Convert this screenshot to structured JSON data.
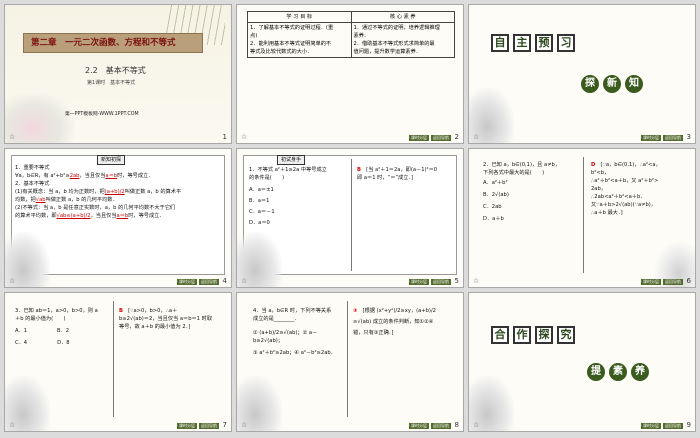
{
  "colors": {
    "frame": "#a8a8a8",
    "accent_green": "#3a5a1e",
    "title_red": "#8b1a1a",
    "answer_red": "#c00000"
  },
  "slides": [
    {
      "num": "1",
      "chapter": "第二章　一元二次函数、方程和不等式",
      "section": "2.2　基本不等式",
      "lesson": "第1课时　基本不等式",
      "site": "第一PPT模板网-WWW.1PPT.COM"
    },
    {
      "num": "2",
      "col1_head": "学 习 目 标",
      "col2_head": "核 心 素 养",
      "col1_lines": [
        "1．了解基本不等式的证明过程．(重",
        "点)",
        "2．能利用基本不等式证明简单的不",
        "等式及比较代数式的大小．"
      ],
      "col2_lines": [
        "1．通过不等式的证明，培养逻辑推理",
        "素养．",
        "2．借助基本不等式形式求简单的最",
        "值问题，提升数学运算素养．"
      ]
    },
    {
      "num": "3",
      "chars_a": [
        "自",
        "主",
        "预",
        "习"
      ],
      "chars_b": [
        "探",
        "新",
        "知"
      ]
    },
    {
      "num": "4",
      "tag": "新知初探",
      "lines": [
        "1．重要不等式",
        "∀a，b∈R，有 a²+b²≥",
        "，当且仅当",
        "时，等号成立．",
        "2．基本不等式",
        "(1)有关概念：当 a，b 均为正数时，把",
        "叫做正数 a，b 的算术平",
        "均数，把",
        "叫做正数 a，b 的几何平均数．",
        "(2)不等式：当 a，b 是任意正实数时，a，b 的几何平均数不大于它们",
        "的算术平均数，即",
        "，当且仅当",
        "时，等号成立．"
      ],
      "fills": [
        "2ab",
        "a＝b",
        "(a+b)/2",
        "√ab",
        "√ab≤(a+b)/2",
        "a＝b"
      ]
    },
    {
      "num": "5",
      "tag": "初试身手",
      "q_lines": [
        "1．不等式 a²＋1≥2a 中等号成立",
        "的条件是(　　)"
      ],
      "options": [
        "A．a＝±1",
        "B．a＝1",
        "C．a＝－1",
        "D．a＝0"
      ],
      "answer": "B",
      "expl": [
        "[当 a²＋1＝2a，即(a－1)²＝0",
        "即 a＝1 时，“＝”成立．]"
      ]
    },
    {
      "num": "6",
      "q_lines": [
        "2．已知 a，b∈(0,1)，且 a≠b，",
        "下列各式中最大的是(　　)"
      ],
      "options": [
        "A．a²＋b²",
        "B．2√(ab)",
        "C．2ab",
        "D．a＋b"
      ],
      "answer": "D",
      "expl": [
        "[∵a，b∈(0,1)，∴a²<a，",
        "b²<b，",
        "∴a²＋b²<a＋b，又 a²＋b²>",
        "2ab，",
        "∴2ab<a²＋b²<a＋b．",
        "又∵a＋b>2√(ab)(∵a≠b)，",
        "∴a＋b 最大．]"
      ]
    },
    {
      "num": "7",
      "q_lines": [
        "3．已知 ab＝1，a>0，b>0，则 a",
        "＋b 的最小值为(　　)"
      ],
      "options": [
        "A．1",
        "B．2",
        "C．4",
        "D．8"
      ],
      "answer": "B",
      "expl": [
        "[∵a>0，b>0，∴a＋",
        "b≥2√(ab)＝2，当且仅当 a＝b＝1 时取",
        "等号，故 a＋b 的最小值为 2．]"
      ]
    },
    {
      "num": "8",
      "q_lines": [
        "4．当 a，b∈R 时，下列不等关系",
        "成立的是________．"
      ],
      "items": [
        "① (a+b)/2≥√(ab)；② a－b≥2√(ab)；",
        "③ a²＋b²≥2ab；④ a²－b²≥2ab．"
      ],
      "answer": "③",
      "expl": [
        "[根据 (x²+y²)/2≥xy，(a+b)/2",
        "≥√(ab) 成立的条件判断，知①②④",
        "错，只有③正确．]"
      ]
    },
    {
      "num": "9",
      "chars_a": [
        "合",
        "作",
        "探",
        "究"
      ],
      "chars_b": [
        "提",
        "素",
        "养"
      ]
    }
  ],
  "footer_buttons": [
    "课时分层",
    "返回导航"
  ]
}
